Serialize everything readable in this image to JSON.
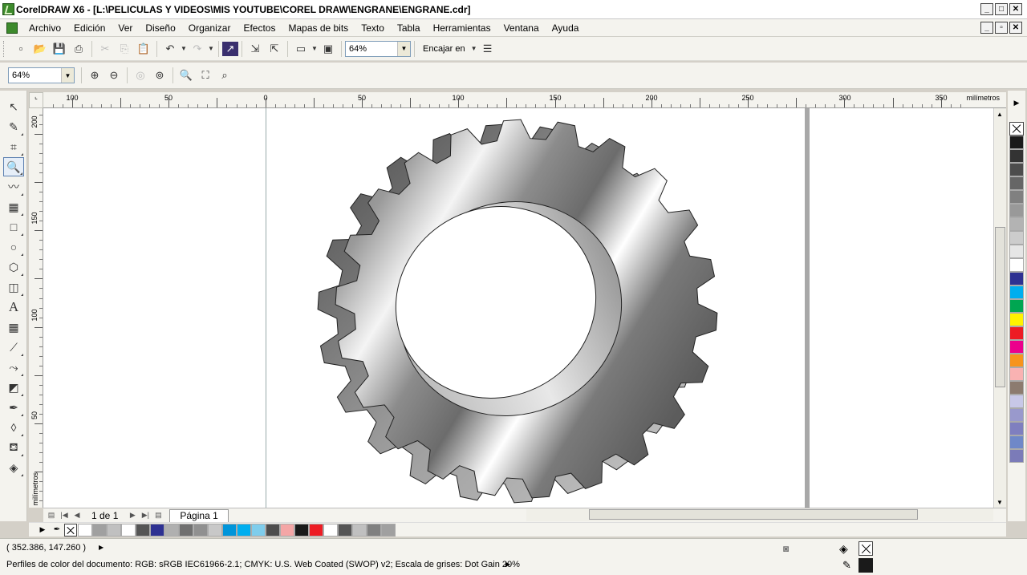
{
  "window": {
    "title": "CorelDRAW X6 - [L:\\PELICULAS Y VIDEOS\\MIS YOUTUBE\\COREL DRAW\\ENGRANE\\ENGRANE.cdr]",
    "controls": [
      "_",
      "□",
      "✕"
    ],
    "doc_controls": [
      "_",
      "▫",
      "✕"
    ]
  },
  "menu": [
    "Archivo",
    "Edición",
    "Ver",
    "Diseño",
    "Organizar",
    "Efectos",
    "Mapas de bits",
    "Texto",
    "Tabla",
    "Herramientas",
    "Ventana",
    "Ayuda"
  ],
  "toolbar1": {
    "zoom_value": "64%",
    "snap_label": "Encajar en"
  },
  "toolbar2": {
    "zoom_value": "64%"
  },
  "toolbox": [
    "pick-tool",
    "shape-tool",
    "crop-tool",
    "zoom-tool",
    "freehand-tool",
    "smart-fill-tool",
    "rectangle-tool",
    "ellipse-tool",
    "polygon-tool",
    "basic-shapes-tool",
    "text-tool",
    "table-tool",
    "dimension-tool",
    "connector-tool",
    "blend-tool",
    "eyedropper-tool",
    "outline-tool",
    "fill-tool",
    "interactive-fill-tool"
  ],
  "ruler": {
    "h_labels": [
      "100",
      "50",
      "0",
      "50",
      "100",
      "150",
      "200",
      "250",
      "300",
      "350"
    ],
    "h_unit": "milímetros",
    "v_labels": [
      "200",
      "150",
      "100",
      "50"
    ],
    "v_unit": "milímetros"
  },
  "pages": {
    "count_label": "1 de 1",
    "tab_label": "Página 1"
  },
  "color_palette": [
    "#1a1a1a",
    "#333333",
    "#4d4d4d",
    "#666666",
    "#808080",
    "#999999",
    "#b3b3b3",
    "#cccccc",
    "#e6e6e6",
    "#ffffff",
    "#2e3192",
    "#00aeef",
    "#00a651",
    "#fff200",
    "#ed1c24",
    "#ec008c",
    "#f7941d",
    "#f9b2b2",
    "#8c7b6f",
    "#c8c8e8",
    "#9999cc",
    "#7f7fbf",
    "#6f88c8",
    "#7b7bb8"
  ],
  "doc_palette": [
    "#ffffff",
    "#a0a0a0",
    "#c0c0c0",
    "#ffffff",
    "#555555",
    "#2e3192",
    "#b0b0b0",
    "#707070",
    "#909090",
    "#c8c8c8",
    "#0095da",
    "#00aeef",
    "#7fcdec",
    "#4d4d4d",
    "#f4a6a6",
    "#1a1a1a",
    "#ed1c24",
    "#ffffff",
    "#555555",
    "#c0c0c0",
    "#808080",
    "#a0a0a0"
  ],
  "status": {
    "coords": "( 352.386, 147.260 )",
    "profiles": "Perfiles de color del documento: RGB: sRGB IEC61966-2.1; CMYK: U.S. Web Coated (SWOP) v2; Escala de grises: Dot Gain 20%"
  }
}
